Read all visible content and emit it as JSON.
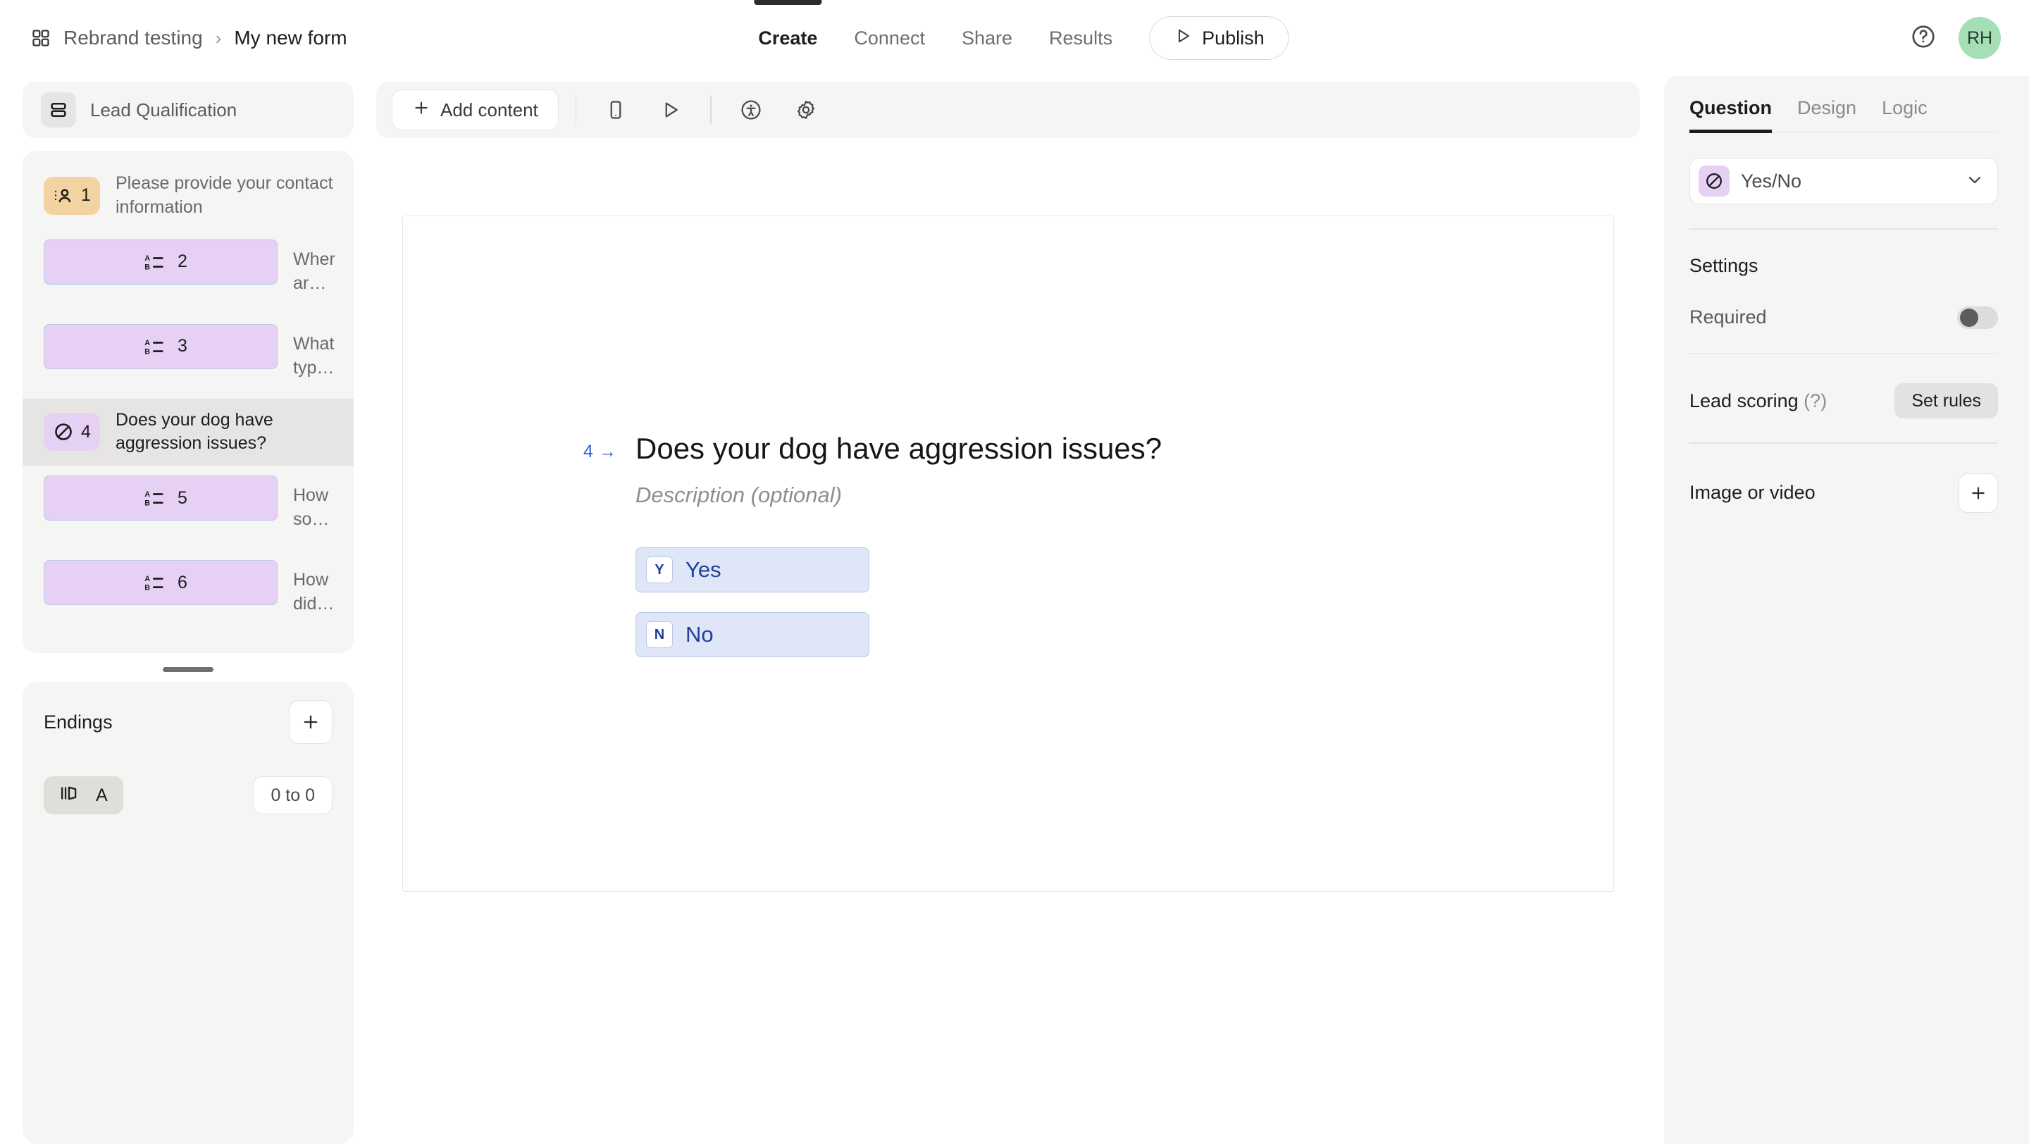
{
  "topbar": {
    "grid_icon": "grid-icon",
    "workspace": "Rebrand testing",
    "separator": "›",
    "form_title": "My new form",
    "tabs": [
      {
        "label": "Create",
        "active": true
      },
      {
        "label": "Connect",
        "active": false
      },
      {
        "label": "Share",
        "active": false
      },
      {
        "label": "Results",
        "active": false
      }
    ],
    "publish_label": "Publish",
    "publish_icon": "play-icon",
    "help_icon": "help-circle-icon",
    "avatar_initials": "RH",
    "avatar_color": "#a5dfb6"
  },
  "sidebar": {
    "group": {
      "title": "Lead Qualification",
      "icon": "layout-rows-icon"
    },
    "questions": [
      {
        "number": "1",
        "label": "Please provide your contact information",
        "icon": "contact-info-icon",
        "badge_color": "#f4d3a3",
        "type": "contact",
        "selected": false
      },
      {
        "number": "2",
        "label": "Where are you located?",
        "icon": "multiple-choice-icon",
        "badge_color": "#e6d1f5",
        "type": "choice",
        "selected": false
      },
      {
        "number": "3",
        "label": "What type of dog training sessions are...",
        "icon": "multiple-choice-icon",
        "badge_color": "#e6d1f5",
        "type": "choice",
        "selected": false
      },
      {
        "number": "4",
        "label": "Does your dog have aggression issues?",
        "icon": "yes-no-icon",
        "badge_color": "#e6d1f5",
        "type": "yesno",
        "selected": true
      },
      {
        "number": "5",
        "label": "How soon are you looking to start the...",
        "icon": "multiple-choice-icon",
        "badge_color": "#e6d1f5",
        "type": "choice",
        "selected": false
      },
      {
        "number": "6",
        "label": "How did you hear about our dog trainin...",
        "icon": "multiple-choice-icon",
        "badge_color": "#e6d1f5",
        "type": "choice",
        "selected": false
      }
    ],
    "endings": {
      "title": "Endings",
      "add_icon": "plus-icon",
      "items": [
        {
          "letter": "A",
          "icon": "ending-card-icon",
          "range": "0 to 0"
        }
      ]
    }
  },
  "toolbar": {
    "add_content_label": "Add content",
    "add_content_icon": "plus-icon",
    "icons": [
      {
        "name": "mobile-preview-icon"
      },
      {
        "name": "play-preview-icon"
      },
      {
        "name": "accessibility-icon"
      },
      {
        "name": "settings-gear-icon"
      }
    ]
  },
  "canvas": {
    "question_index": "4",
    "index_arrow": "→",
    "question_title": "Does your dog have aggression issues?",
    "description_placeholder": "Description (optional)",
    "choices": [
      {
        "key": "Y",
        "label": "Yes"
      },
      {
        "key": "N",
        "label": "No"
      }
    ],
    "accent_color": "#20409a"
  },
  "right_panel": {
    "tabs": [
      {
        "label": "Question",
        "active": true
      },
      {
        "label": "Design",
        "active": false
      },
      {
        "label": "Logic",
        "active": false
      }
    ],
    "question_type": {
      "label": "Yes/No",
      "icon": "yes-no-icon",
      "chevron": "chevron-down-icon"
    },
    "settings_title": "Settings",
    "required": {
      "label": "Required",
      "enabled": false
    },
    "lead_scoring": {
      "label": "Lead scoring",
      "hint": "(?)",
      "button_label": "Set rules"
    },
    "image_or_video": {
      "label": "Image or video",
      "add_icon": "plus-icon"
    }
  }
}
